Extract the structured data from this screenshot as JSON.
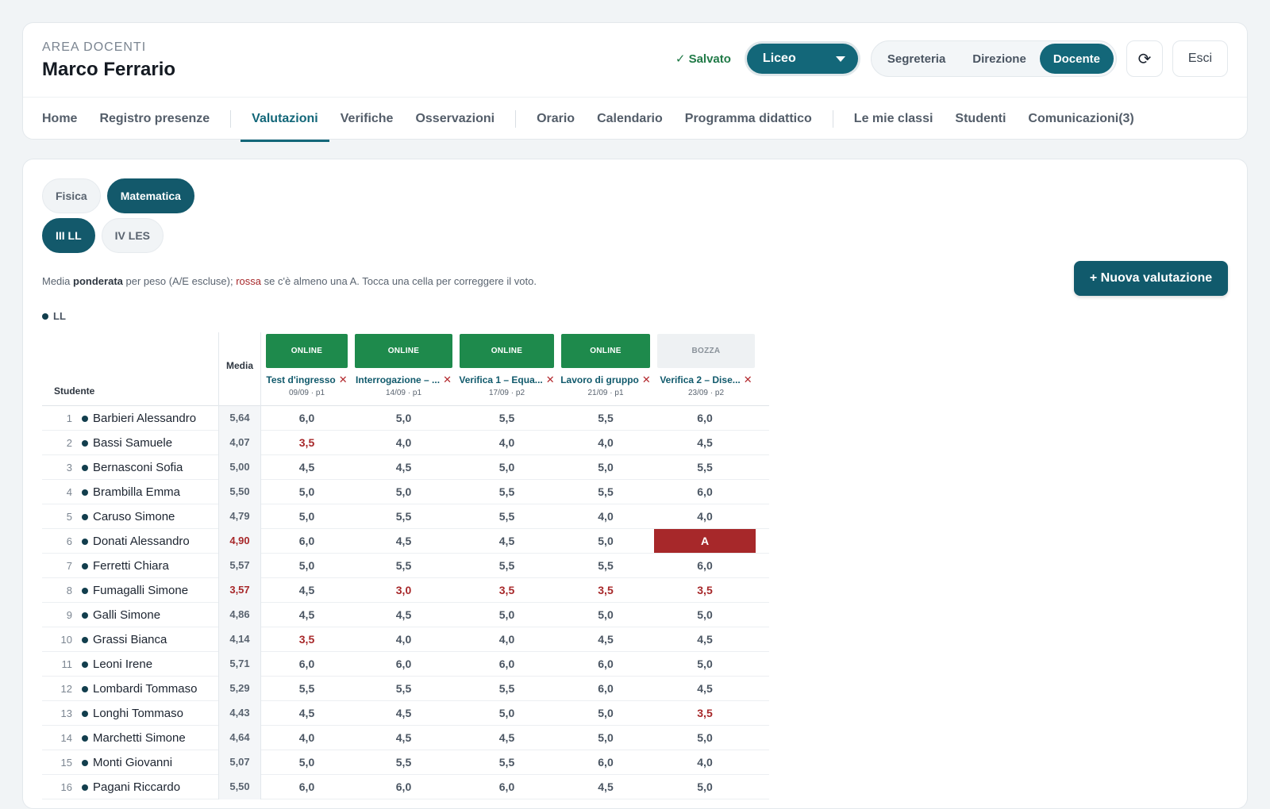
{
  "header": {
    "area_label": "AREA DOCENTI",
    "teacher_name": "Marco Ferrario",
    "saved_status": "✓ Salvato",
    "school_select": "Liceo",
    "roles": [
      {
        "label": "Segreteria",
        "active": false
      },
      {
        "label": "Direzione",
        "active": false
      },
      {
        "label": "Docente",
        "active": true
      }
    ],
    "refresh_icon": "⟳",
    "exit_label": "Esci"
  },
  "nav": {
    "groups": [
      [
        {
          "label": "Home"
        },
        {
          "label": "Registro presenze"
        }
      ],
      [
        {
          "label": "Valutazioni",
          "active": true
        },
        {
          "label": "Verifiche"
        },
        {
          "label": "Osservazioni"
        }
      ],
      [
        {
          "label": "Orario"
        },
        {
          "label": "Calendario"
        },
        {
          "label": "Programma didattico"
        }
      ],
      [
        {
          "label": "Le mie classi"
        },
        {
          "label": "Studenti"
        },
        {
          "label": "Comunicazioni(3)"
        }
      ]
    ]
  },
  "filters": {
    "subjects": [
      {
        "label": "Fisica",
        "active": false
      },
      {
        "label": "Matematica",
        "active": true
      }
    ],
    "classes": [
      {
        "label": "III LL",
        "active": true
      },
      {
        "label": "IV LES",
        "active": false
      }
    ]
  },
  "hint": {
    "part1": "Media ",
    "bold": "ponderata",
    "part2": " per peso (A/E escluse); ",
    "red": "rossa",
    "part3": " se c'è almeno una A. Tocca una cella per correggere il voto."
  },
  "new_button": "+ Nuova valutazione",
  "legend_label": "LL",
  "table": {
    "student_header": "Studente",
    "media_header": "Media",
    "delete_icon": "✕",
    "evaluations": [
      {
        "status": "ONLINE",
        "title": "Test d'ingresso",
        "meta": "09/09 · p1"
      },
      {
        "status": "ONLINE",
        "title": "Interrogazione – ...",
        "meta": "14/09 · p1"
      },
      {
        "status": "ONLINE",
        "title": "Verifica 1 – Equa...",
        "meta": "17/09 · p2"
      },
      {
        "status": "ONLINE",
        "title": "Lavoro di gruppo",
        "meta": "21/09 · p1"
      },
      {
        "status": "BOZZA",
        "title": "Verifica 2 – Dise...",
        "meta": "23/09 · p2"
      }
    ],
    "students": [
      {
        "num": "1",
        "name": "Barbieri Alessandro",
        "media": "5,64",
        "media_low": false,
        "grades": [
          "6,0",
          "5,0",
          "5,5",
          "5,5",
          "6,0"
        ]
      },
      {
        "num": "2",
        "name": "Bassi Samuele",
        "media": "4,07",
        "media_low": false,
        "grades": [
          "3,5",
          "4,0",
          "4,0",
          "4,0",
          "4,5"
        ]
      },
      {
        "num": "3",
        "name": "Bernasconi Sofia",
        "media": "5,00",
        "media_low": false,
        "grades": [
          "4,5",
          "4,5",
          "5,0",
          "5,0",
          "5,5"
        ]
      },
      {
        "num": "4",
        "name": "Brambilla Emma",
        "media": "5,50",
        "media_low": false,
        "grades": [
          "5,0",
          "5,0",
          "5,5",
          "5,5",
          "6,0"
        ]
      },
      {
        "num": "5",
        "name": "Caruso Simone",
        "media": "4,79",
        "media_low": false,
        "grades": [
          "5,0",
          "5,5",
          "5,5",
          "4,0",
          "4,0"
        ]
      },
      {
        "num": "6",
        "name": "Donati Alessandro",
        "media": "4,90",
        "media_low": true,
        "grades": [
          "6,0",
          "4,5",
          "4,5",
          "5,0",
          "A"
        ]
      },
      {
        "num": "7",
        "name": "Ferretti Chiara",
        "media": "5,57",
        "media_low": false,
        "grades": [
          "5,0",
          "5,5",
          "5,5",
          "5,5",
          "6,0"
        ]
      },
      {
        "num": "8",
        "name": "Fumagalli Simone",
        "media": "3,57",
        "media_low": true,
        "grades": [
          "4,5",
          "3,0",
          "3,5",
          "3,5",
          "3,5"
        ]
      },
      {
        "num": "9",
        "name": "Galli Simone",
        "media": "4,86",
        "media_low": false,
        "grades": [
          "4,5",
          "4,5",
          "5,0",
          "5,0",
          "5,0"
        ]
      },
      {
        "num": "10",
        "name": "Grassi Bianca",
        "media": "4,14",
        "media_low": false,
        "grades": [
          "3,5",
          "4,0",
          "4,0",
          "4,5",
          "4,5"
        ]
      },
      {
        "num": "11",
        "name": "Leoni Irene",
        "media": "5,71",
        "media_low": false,
        "grades": [
          "6,0",
          "6,0",
          "6,0",
          "6,0",
          "5,0"
        ]
      },
      {
        "num": "12",
        "name": "Lombardi Tommaso",
        "media": "5,29",
        "media_low": false,
        "grades": [
          "5,5",
          "5,5",
          "5,5",
          "6,0",
          "4,5"
        ]
      },
      {
        "num": "13",
        "name": "Longhi Tommaso",
        "media": "4,43",
        "media_low": false,
        "grades": [
          "4,5",
          "4,5",
          "5,0",
          "5,0",
          "3,5"
        ]
      },
      {
        "num": "14",
        "name": "Marchetti Simone",
        "media": "4,64",
        "media_low": false,
        "grades": [
          "4,0",
          "4,5",
          "4,5",
          "5,0",
          "5,0"
        ]
      },
      {
        "num": "15",
        "name": "Monti Giovanni",
        "media": "5,07",
        "media_low": false,
        "grades": [
          "5,0",
          "5,5",
          "5,5",
          "6,0",
          "4,0"
        ]
      },
      {
        "num": "16",
        "name": "Pagani Riccardo",
        "media": "5,50",
        "media_low": false,
        "grades": [
          "6,0",
          "6,0",
          "6,0",
          "4,5",
          "5,0"
        ]
      }
    ]
  }
}
